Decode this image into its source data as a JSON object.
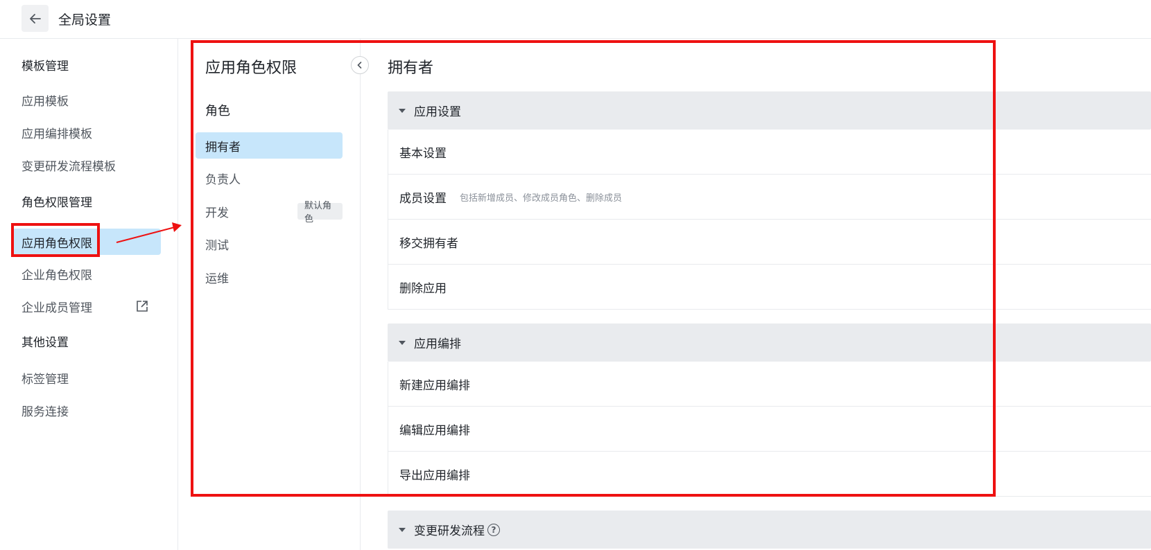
{
  "header": {
    "title": "全局设置",
    "back_icon": "arrow-left-icon"
  },
  "leftnav": {
    "groups": [
      {
        "label": "模板管理"
      },
      {
        "label": "角色权限管理"
      },
      {
        "label": "其他设置"
      }
    ],
    "items": [
      {
        "label": "应用模板",
        "active": false
      },
      {
        "label": "应用编排模板",
        "active": false
      },
      {
        "label": "变更研发流程模板",
        "active": false
      },
      {
        "label": "应用角色权限",
        "active": true
      },
      {
        "label": "企业角色权限",
        "active": false
      },
      {
        "label": "企业成员管理",
        "active": false,
        "icon": "external-link-icon"
      },
      {
        "label": "标签管理",
        "active": false
      },
      {
        "label": "服务连接",
        "active": false
      }
    ]
  },
  "roles": {
    "title": "应用角色权限",
    "subtitle": "角色",
    "items": [
      {
        "label": "拥有者",
        "active": true
      },
      {
        "label": "负责人",
        "active": false
      },
      {
        "label": "开发",
        "active": false,
        "badge": "默认角色"
      },
      {
        "label": "测试",
        "active": false
      },
      {
        "label": "运维",
        "active": false
      }
    ],
    "collapse_icon": "chevron-left-icon"
  },
  "main": {
    "title": "拥有者",
    "sections": [
      {
        "title": "应用设置",
        "rows": [
          {
            "label": "基本设置",
            "desc": ""
          },
          {
            "label": "成员设置",
            "desc": "包括新增成员、修改成员角色、删除成员"
          },
          {
            "label": "移交拥有者",
            "desc": ""
          },
          {
            "label": "删除应用",
            "desc": ""
          }
        ]
      },
      {
        "title": "应用编排",
        "rows": [
          {
            "label": "新建应用编排",
            "desc": ""
          },
          {
            "label": "编辑应用编排",
            "desc": ""
          },
          {
            "label": "导出应用编排",
            "desc": ""
          }
        ]
      },
      {
        "title": "变更研发流程",
        "help": "?",
        "rows": []
      }
    ]
  },
  "colors": {
    "active_bg": "#c7e6fb",
    "section_bg": "#e9ebee",
    "annotation_red": "#ee1111"
  }
}
